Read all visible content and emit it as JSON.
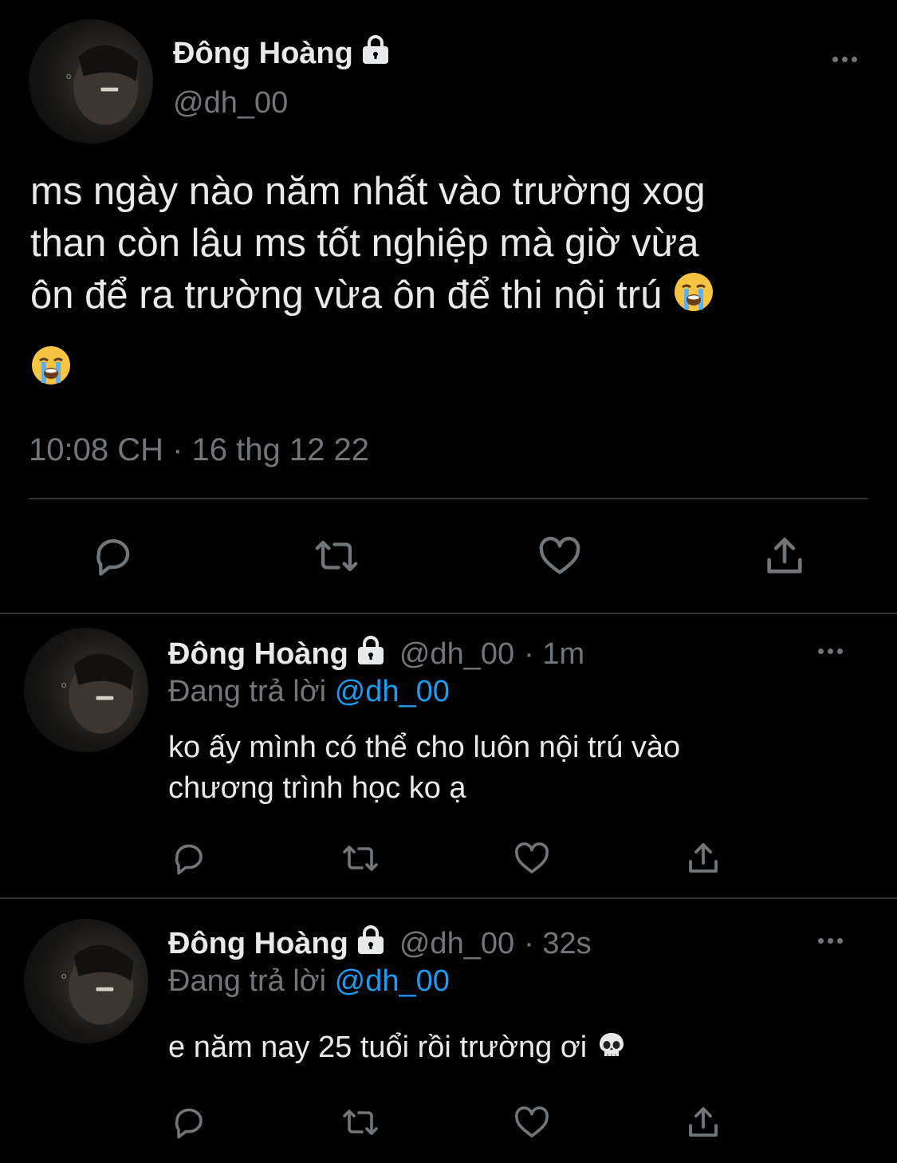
{
  "main_tweet": {
    "display_name": "Đông Hoàng",
    "handle": "@dh_00",
    "text_lines": [
      "ms ngày nào năm nhất vào trường xog",
      "than còn lâu ms tốt nghiệp mà giờ vừa",
      "ôn để ra trường vừa ôn để thi nội trú"
    ],
    "emoji": "loudly-crying-face",
    "timestamp": "10:08 CH · 16 thg 12 22"
  },
  "replies": [
    {
      "display_name": "Đông Hoàng",
      "handle": "@dh_00",
      "time": "· 1m",
      "replying_prefix": "Đang trả lời",
      "replying_to": "@dh_00",
      "text_lines": [
        "ko ấy mình có thể cho luôn nội trú vào",
        "chương trình học ko ạ"
      ]
    },
    {
      "display_name": "Đông Hoàng",
      "handle": "@dh_00",
      "time": "· 32s",
      "replying_prefix": "Đang trả lời",
      "replying_to": "@dh_00",
      "text_line": "e năm nay 25 tuổi rồi trường ơi",
      "emoji": "skull"
    }
  ],
  "icons": [
    "lock-icon",
    "more-icon",
    "reply-icon",
    "retweet-icon",
    "like-icon",
    "share-icon"
  ],
  "colors": {
    "background": "#000000",
    "text": "#e7e9ea",
    "muted": "#71767b",
    "accent": "#1d9bf0",
    "divider": "#2f3336"
  }
}
